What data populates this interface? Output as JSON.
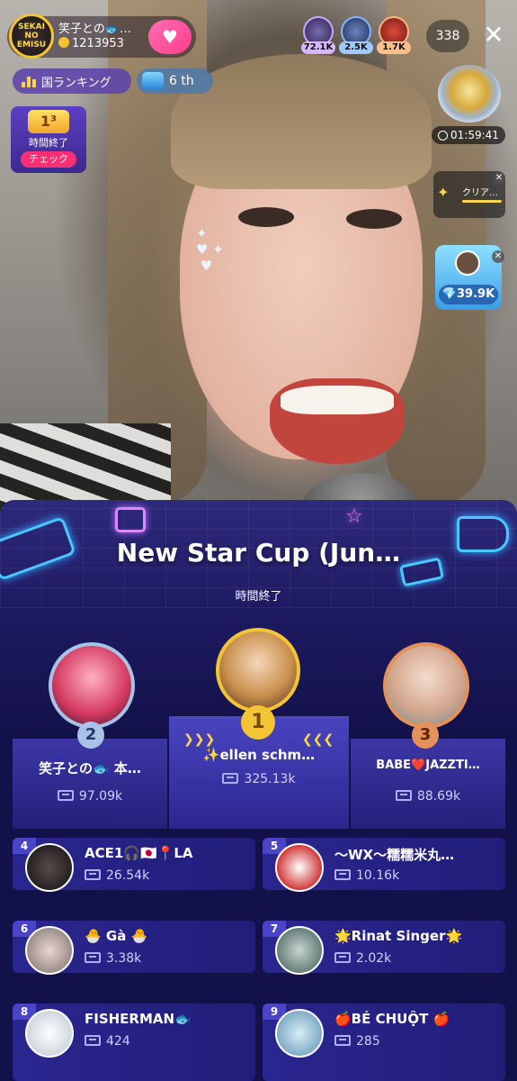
{
  "host": {
    "name": "笑子との🐟…",
    "coins": "1213953",
    "avatar_text": "SEKAI NO EMISU"
  },
  "badges": {
    "country_ranking": "国ランキング",
    "rank_position": "6 th"
  },
  "event_card": {
    "badge": "1³",
    "status": "時間終了",
    "check_button": "チェック"
  },
  "top_viewers": [
    {
      "count": "72.1K"
    },
    {
      "count": "2.5K"
    },
    {
      "count": "1.7K"
    }
  ],
  "online_count": "338",
  "close_glyph": "✕",
  "timer": "01:59:41",
  "clear_widget": {
    "label": "クリア…"
  },
  "diamond_widget": {
    "value": "💎39.9K"
  },
  "cup": {
    "title": "New Star Cup (Jun…",
    "status": "時間終了",
    "podium": [
      {
        "rank": "1",
        "name": "✨ellen schm…",
        "score": "325.13k"
      },
      {
        "rank": "2",
        "name": "笑子との🐟 本…",
        "score": "97.09k"
      },
      {
        "rank": "3",
        "name": "BABE❤️JAZZTI…",
        "score": "88.69k"
      }
    ],
    "list": [
      {
        "rank": "4",
        "name": "ACE1🎧🇯🇵📍LA",
        "score": "26.54k"
      },
      {
        "rank": "5",
        "name": "〜WX〜糯糯米丸…",
        "score": "10.16k"
      },
      {
        "rank": "6",
        "name": "🐣 Gà 🐣",
        "score": "3.38k"
      },
      {
        "rank": "7",
        "name": "🌟Rinat Singer🌟",
        "score": "2.02k"
      },
      {
        "rank": "8",
        "name": "FISHERMAN🐟",
        "score": "424"
      },
      {
        "rank": "9",
        "name": "🍎BÉ CHUỘT 🍎",
        "score": "285"
      }
    ]
  },
  "colors": {
    "panel_bg": "#13114a",
    "card_bg": "#2a2690",
    "gold": "#f3c433",
    "silver": "#a9c3e6",
    "bronze": "#e7915a",
    "check_button": "#ff2f73"
  }
}
